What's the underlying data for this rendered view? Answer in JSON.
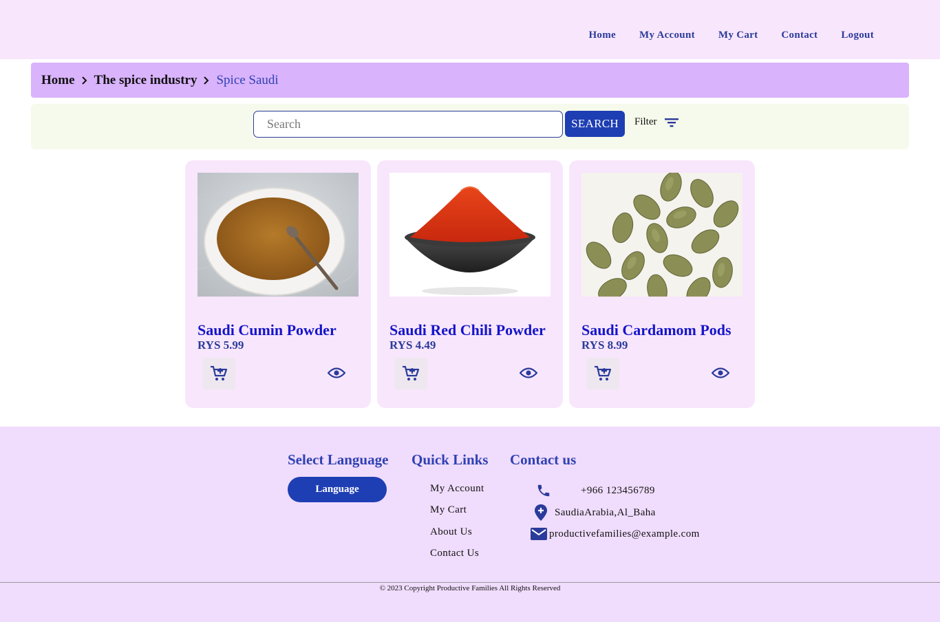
{
  "nav": {
    "items": [
      "Home",
      "My Account",
      "My Cart",
      "Contact",
      "Logout"
    ]
  },
  "breadcrumb": {
    "items": [
      "Home",
      "The spice industry",
      "Spice Saudi"
    ]
  },
  "search": {
    "placeholder": "Search",
    "button_label": "SEARCH",
    "filter_label": "Filter"
  },
  "products": [
    {
      "name": "Saudi Cumin Powder",
      "price": "RYS 5.99"
    },
    {
      "name": "Saudi Red Chili Powder",
      "price": "RYS 4.49"
    },
    {
      "name": "Saudi Cardamom Pods",
      "price": "RYS 8.99"
    }
  ],
  "footer": {
    "language_heading": "Select Language",
    "language_button": "Language",
    "quick_links_heading": "Quick Links",
    "quick_links": [
      "My Account",
      "My Cart",
      "About Us",
      "Contact Us"
    ],
    "contact_heading": "Contact us",
    "phone": "+966 123456789",
    "address": "SaudiaArabia,Al_Baha",
    "email": "productivefamilies@example.com",
    "copyright": "© 2023 Copyright Productive Families All Rights Reserved"
  },
  "colors": {
    "header_bg": "#f8e6fc",
    "breadcrumb_bg": "#d9b3fc",
    "accent": "#1e3eb3",
    "product_title": "#1515c9",
    "footer_bg": "#f0dcfc"
  },
  "icons": [
    "chevron-right-icon",
    "filter-icon",
    "add-to-cart-icon",
    "eye-icon",
    "phone-icon",
    "location-icon",
    "mail-icon"
  ]
}
